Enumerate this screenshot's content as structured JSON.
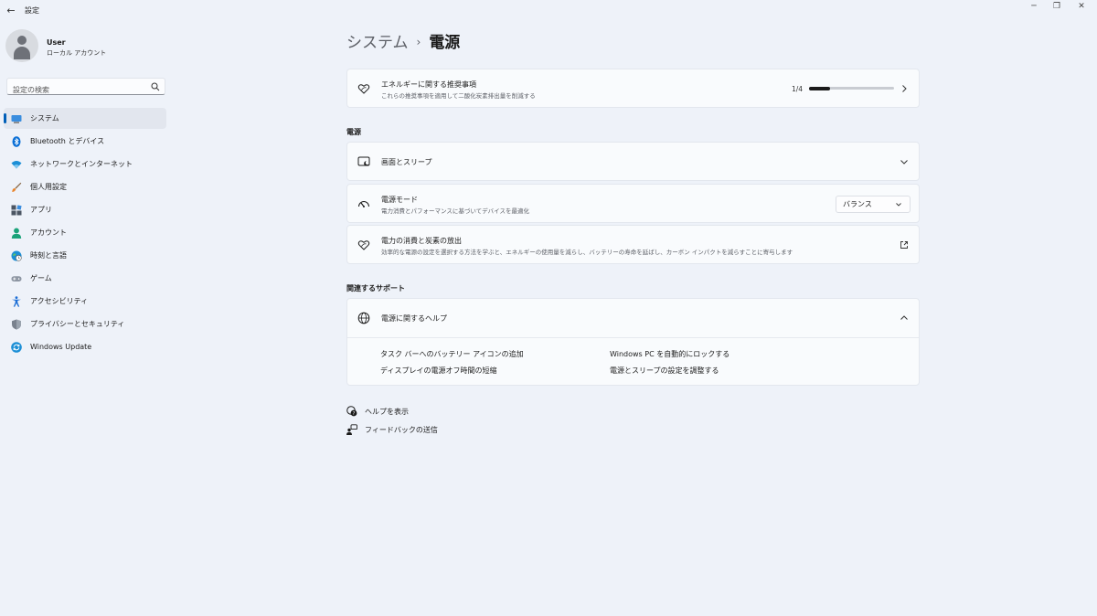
{
  "window": {
    "back_glyph": "←",
    "title": "設定",
    "minimize_glyph": "─",
    "maximize_glyph": "❐",
    "close_glyph": "✕"
  },
  "user": {
    "name": "User",
    "account_type": "ローカル アカウント"
  },
  "search": {
    "placeholder": "設定の検索"
  },
  "nav": {
    "items": [
      {
        "label": "システム",
        "icon": "system-icon",
        "selected": true
      },
      {
        "label": "Bluetooth とデバイス",
        "icon": "bluetooth-icon"
      },
      {
        "label": "ネットワークとインターネット",
        "icon": "wifi-icon"
      },
      {
        "label": "個人用設定",
        "icon": "brush-icon"
      },
      {
        "label": "アプリ",
        "icon": "apps-icon"
      },
      {
        "label": "アカウント",
        "icon": "account-icon"
      },
      {
        "label": "時刻と言語",
        "icon": "globe-clock-icon"
      },
      {
        "label": "ゲーム",
        "icon": "gamepad-icon"
      },
      {
        "label": "アクセシビリティ",
        "icon": "accessibility-icon"
      },
      {
        "label": "プライバシーとセキュリティ",
        "icon": "shield-icon"
      },
      {
        "label": "Windows Update",
        "icon": "update-icon"
      }
    ]
  },
  "breadcrumb": {
    "parent": "システム",
    "separator": "›",
    "current": "電源"
  },
  "energy_recommendations": {
    "title": "エネルギーに関する推奨事項",
    "subtitle": "これらの推奨事項を適用して二酸化炭素排出量を削減する",
    "progress_text": "1/4",
    "progress_fraction": 0.25,
    "icon": "leaf-heart-icon"
  },
  "power_section": {
    "title": "電源",
    "screen_sleep": {
      "title": "画面とスリープ",
      "icon": "screen-sleep-icon"
    },
    "power_mode": {
      "title": "電源モード",
      "subtitle": "電力消費とパフォーマンスに基づいてデバイスを最適化",
      "selected_value": "バランス",
      "icon": "gauge-icon"
    },
    "consumption": {
      "title": "電力の消費と炭素の放出",
      "subtitle": "効率的な電源の設定を選択する方法を学ぶと、エネルギーの使用量を減らし、バッテリーの寿命を延ばし、カーボン インパクトを減らすことに寄与します",
      "icon": "leaf-heart-icon",
      "action_icon": "external-link-icon"
    }
  },
  "support": {
    "title": "関連するサポート",
    "help": {
      "title": "電源に関するヘルプ",
      "icon": "globe-icon",
      "links": [
        "タスク バーへのバッテリー アイコンの追加",
        "Windows PC を自動的にロックする",
        "ディスプレイの電源オフ時間の短縮",
        "電源とスリープの設定を調整する"
      ]
    }
  },
  "bottom_links": {
    "get_help": "ヘルプを表示",
    "feedback": "フィードバックの送信"
  },
  "colors": {
    "accent": "#005fb8",
    "background": "#eef2f9",
    "card": "#f9fbfd"
  }
}
